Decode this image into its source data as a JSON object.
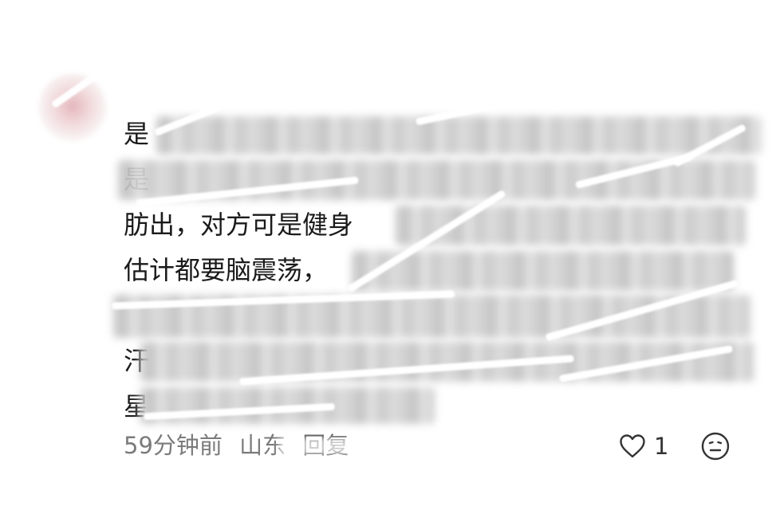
{
  "comment": {
    "lines": [
      "是",
      "是",
      "肪出，对方可是健身",
      "估计都要脑震荡，",
      "",
      "汗",
      "星"
    ]
  },
  "meta": {
    "time": "59分钟前",
    "location": "山东",
    "reply_label": "回复"
  },
  "actions": {
    "like_count": "1",
    "like_icon": "heart-outline-icon",
    "dislike_icon": "face-neutral-icon"
  },
  "colors": {
    "meta_text": "#7b7b7b",
    "body_text": "#1a1a1a"
  }
}
